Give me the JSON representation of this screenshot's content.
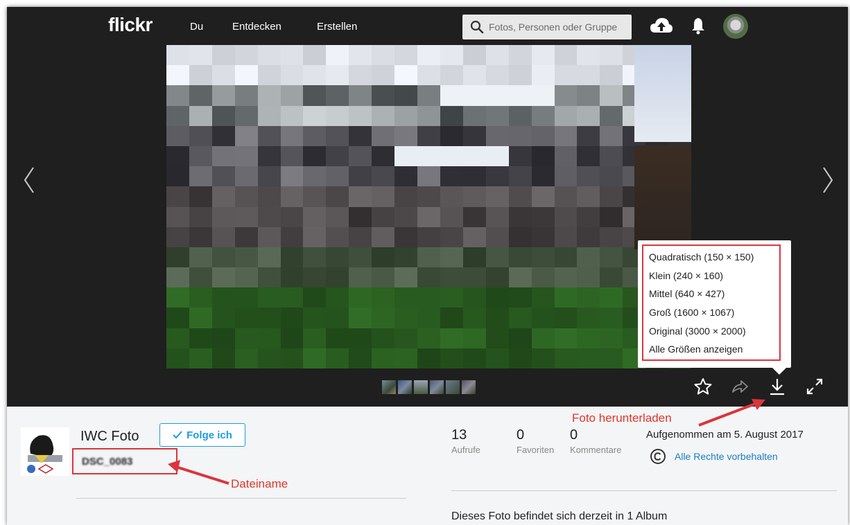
{
  "nav": {
    "logo": "flickr",
    "links": [
      "Du",
      "Entdecken",
      "Erstellen"
    ],
    "search_placeholder": "Fotos, Personen oder Gruppe"
  },
  "download_menu": {
    "items": [
      "Quadratisch (150 × 150)",
      "Klein (240 × 160)",
      "Mittel (640 × 427)",
      "Groß (1600 × 1067)",
      "Original (3000 × 2000)",
      "Alle Größen anzeigen"
    ]
  },
  "owner": {
    "name": "IWC Foto",
    "follow_label": "Folge ich",
    "filename": "DSC_0083"
  },
  "stats": [
    {
      "value": "13",
      "label": "Aufrufe"
    },
    {
      "value": "0",
      "label": "Favoriten"
    },
    {
      "value": "0",
      "label": "Kommentare"
    }
  ],
  "taken": "Aufgenommen am 5. August 2017",
  "rights": "Alle Rechte vorbehalten",
  "album_text": "Dieses Foto befindet sich derzeit in 1 Album",
  "annotations": {
    "download": "Foto herunterladen",
    "filename": "Dateiname"
  },
  "colors": {
    "annotation_red": "#d9363e",
    "link_blue": "#1c9be6",
    "nav_bg": "#1f1f1f"
  }
}
